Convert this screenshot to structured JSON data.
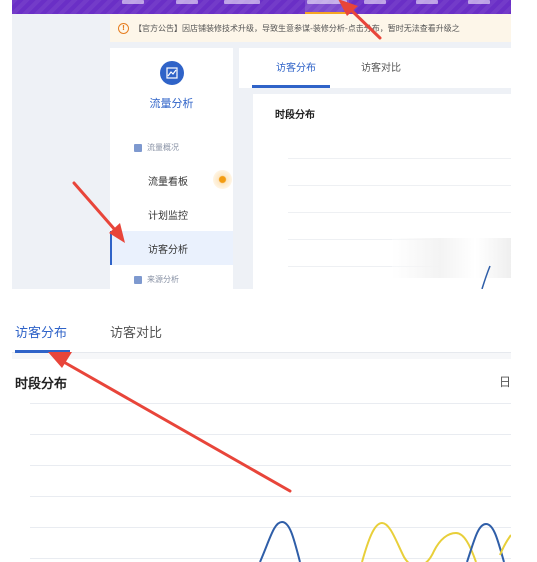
{
  "top_panel": {
    "notice_text": "【官方公告】因店铺装修技术升级，导致生意参谋-装修分析-点击分布，暂时无法查看升级之",
    "sidebar": {
      "title": "流量分析",
      "groups": [
        {
          "label": "流量概况"
        },
        {
          "label": "来源分析"
        }
      ],
      "items": [
        {
          "label": "流量看板"
        },
        {
          "label": "计划监控"
        },
        {
          "label": "访客分析"
        }
      ]
    },
    "tabs": [
      {
        "label": "访客分布"
      },
      {
        "label": "访客对比"
      }
    ],
    "chart_title": "时段分布"
  },
  "bottom_panel": {
    "tabs": [
      {
        "label": "访客分布"
      },
      {
        "label": "访客对比"
      }
    ],
    "chart_title": "时段分布",
    "cut_label": "日"
  },
  "colors": {
    "accent": "#2f63c8",
    "annotation_arrow": "#e8453a",
    "series_blue": "#2f5ea8",
    "series_yellow": "#e8cf3a",
    "nav_bar": "#6a2fc6"
  },
  "icons": {
    "notice": "warning-icon",
    "flow": "line-chart-icon",
    "group": "building-icon"
  }
}
